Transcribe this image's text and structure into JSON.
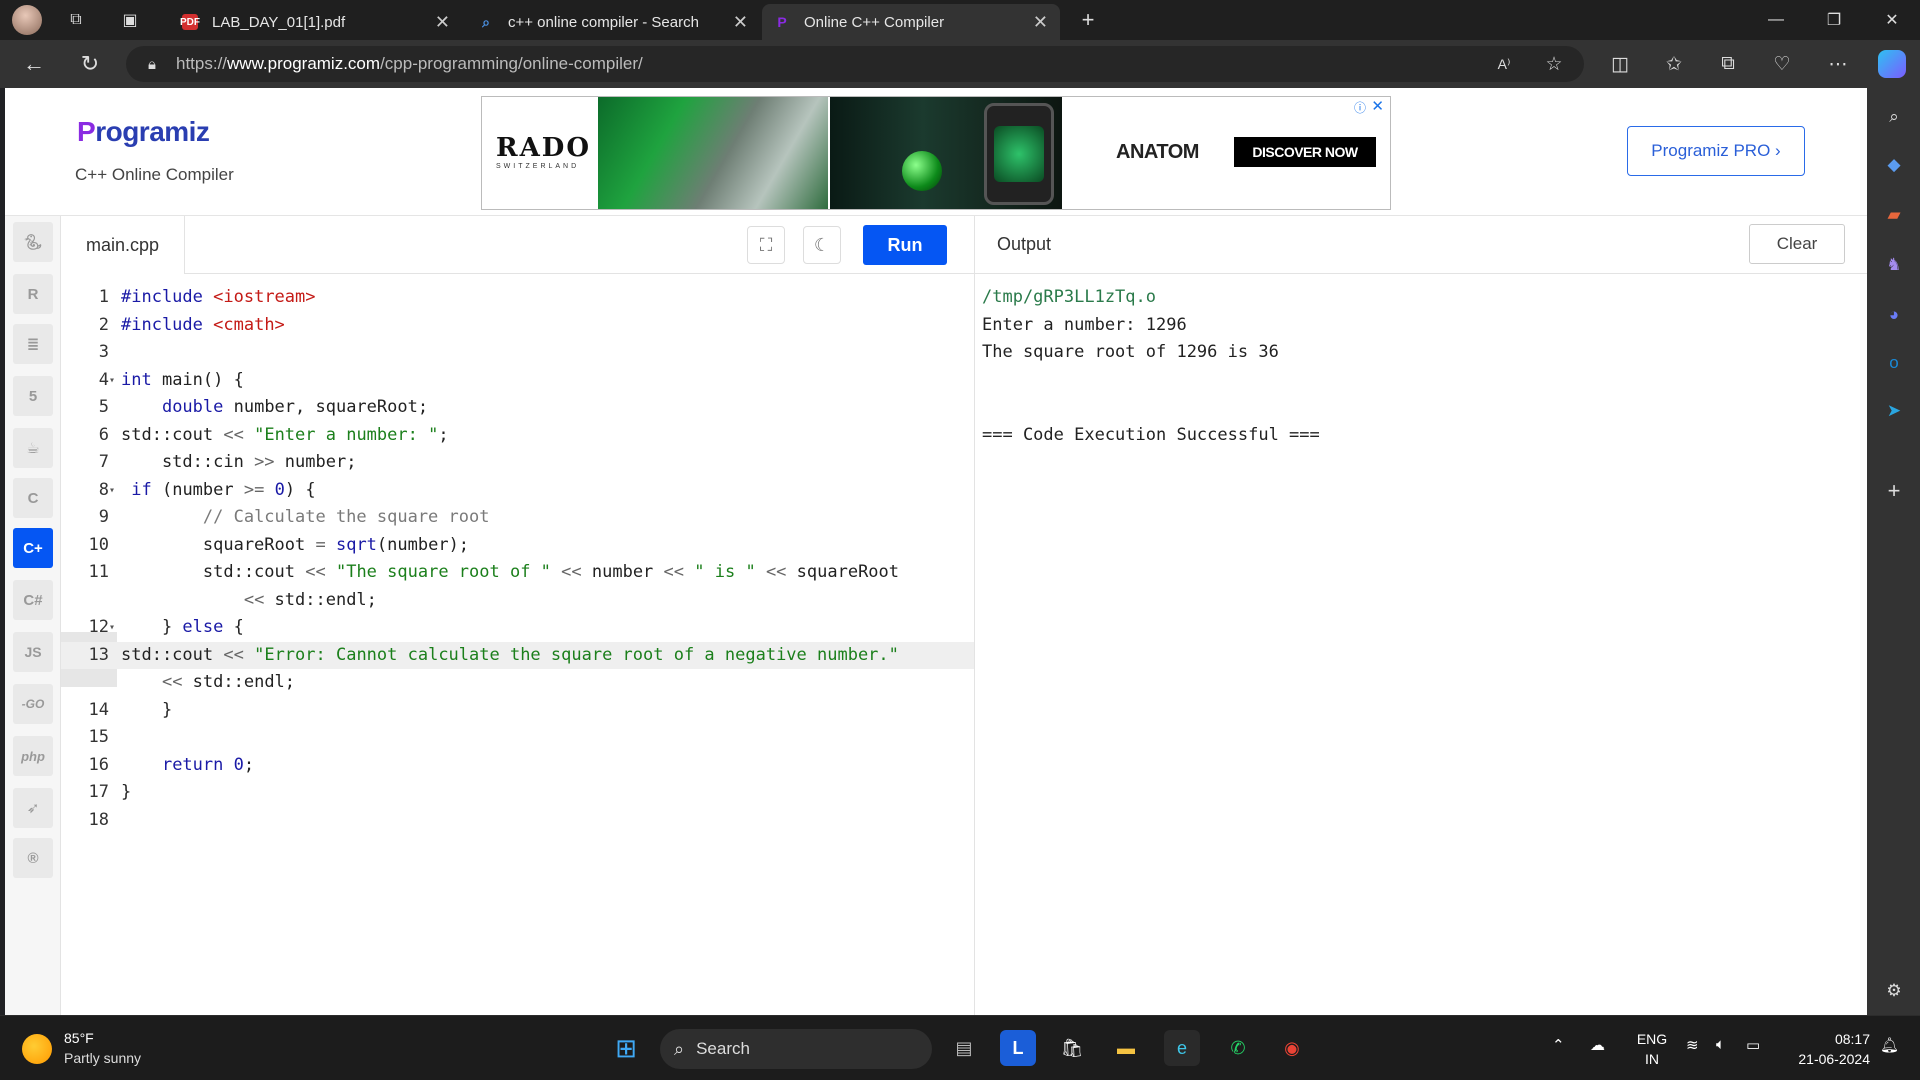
{
  "browser": {
    "tabs": [
      {
        "title": "LAB_DAY_01[1].pdf",
        "favicon": "PDF"
      },
      {
        "title": "c++ online compiler - Search",
        "favicon": "search"
      },
      {
        "title": "Online C++ Compiler",
        "favicon": "programiz"
      }
    ],
    "url_scheme": "https://",
    "url_host": "www.programiz.com",
    "url_path": "/cpp-programming/online-compiler/"
  },
  "header": {
    "logo": "rogramiz",
    "logo_p": "P",
    "subtitle": "C++ Online Compiler",
    "pro_button": "Programiz PRO ›"
  },
  "ad": {
    "brand": "RADO",
    "brand_sub": "SWITZERLAND",
    "product": "ANATOM",
    "cta": "DISCOVER NOW"
  },
  "langs": [
    "python",
    "r",
    "sql",
    "html",
    "java",
    "c",
    "cpp",
    "csharp",
    "JS",
    "-GO",
    "php",
    "swift",
    "rust"
  ],
  "editor": {
    "file_tab": "main.cpp",
    "run_label": "Run",
    "lines": [
      {
        "n": "1",
        "text": "#include <iostream>"
      },
      {
        "n": "2",
        "text": "#include <cmath>"
      },
      {
        "n": "3",
        "text": ""
      },
      {
        "n": "4",
        "text": "int main() {"
      },
      {
        "n": "5",
        "text": "    double number, squareRoot;"
      },
      {
        "n": "6",
        "text": "std::cout << \"Enter a number: \";"
      },
      {
        "n": "7",
        "text": "    std::cin >> number;"
      },
      {
        "n": "8",
        "text": " if (number >= 0) {"
      },
      {
        "n": "9",
        "text": "        // Calculate the square root"
      },
      {
        "n": "10",
        "text": "        squareRoot = sqrt(number);"
      },
      {
        "n": "11",
        "text": "        std::cout << \"The square root of \" << number << \" is \" << squareRoot"
      },
      {
        "n": "",
        "text": "            << std::endl;"
      },
      {
        "n": "12",
        "text": "    } else {"
      },
      {
        "n": "13",
        "text": "std::cout << \"Error: Cannot calculate the square root of a negative number.\""
      },
      {
        "n": "",
        "text": "    << std::endl;"
      },
      {
        "n": "14",
        "text": "    }"
      },
      {
        "n": "15",
        "text": ""
      },
      {
        "n": "16",
        "text": "    return 0;"
      },
      {
        "n": "17",
        "text": "}"
      },
      {
        "n": "18",
        "text": ""
      }
    ]
  },
  "output": {
    "title": "Output",
    "clear_label": "Clear",
    "lines": [
      "/tmp/gRP3LL1zTq.o",
      "Enter a number: 1296",
      "The square root of 1296 is 36",
      "",
      "",
      "=== Code Execution Successful ==="
    ]
  },
  "taskbar": {
    "temp": "85°F",
    "weather": "Partly sunny",
    "search": "Search",
    "lang1": "ENG",
    "lang2": "IN",
    "time": "08:17",
    "date": "21-06-2024"
  }
}
